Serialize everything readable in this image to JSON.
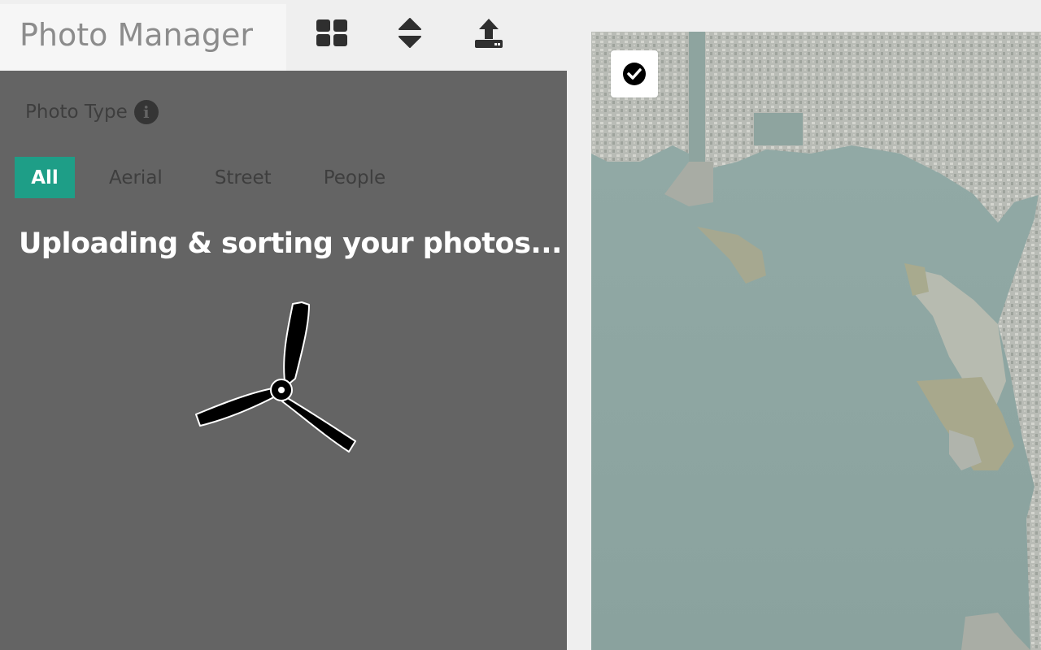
{
  "app": {
    "title": "Photo Manager"
  },
  "toolbar": {
    "buttons": [
      {
        "icon": "grid-icon"
      },
      {
        "icon": "sort-icon"
      },
      {
        "icon": "upload-icon"
      }
    ]
  },
  "filter": {
    "label": "Photo Type",
    "info_icon": "info-icon",
    "tabs": [
      {
        "label": "All",
        "active": true
      },
      {
        "label": "Aerial",
        "active": false
      },
      {
        "label": "Street",
        "active": false
      },
      {
        "label": "People",
        "active": false
      }
    ],
    "accent_color": "#1e9e87"
  },
  "status": {
    "message": "Uploading & sorting your photos..."
  },
  "map": {
    "check_icon": "check-circle-icon"
  }
}
